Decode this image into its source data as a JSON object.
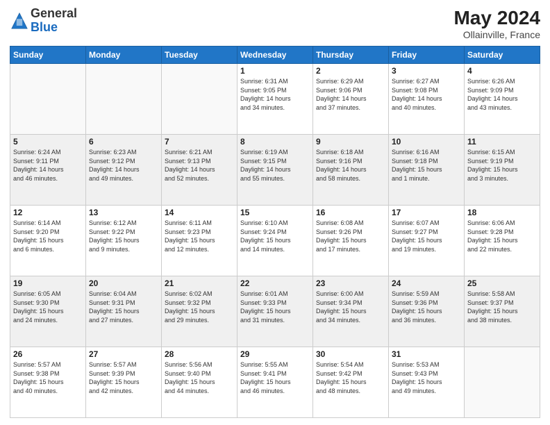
{
  "logo": {
    "general": "General",
    "blue": "Blue"
  },
  "title": {
    "month_year": "May 2024",
    "location": "Ollainville, France"
  },
  "days_of_week": [
    "Sunday",
    "Monday",
    "Tuesday",
    "Wednesday",
    "Thursday",
    "Friday",
    "Saturday"
  ],
  "weeks": [
    [
      {
        "day": "",
        "detail": ""
      },
      {
        "day": "",
        "detail": ""
      },
      {
        "day": "",
        "detail": ""
      },
      {
        "day": "1",
        "detail": "Sunrise: 6:31 AM\nSunset: 9:05 PM\nDaylight: 14 hours\nand 34 minutes."
      },
      {
        "day": "2",
        "detail": "Sunrise: 6:29 AM\nSunset: 9:06 PM\nDaylight: 14 hours\nand 37 minutes."
      },
      {
        "day": "3",
        "detail": "Sunrise: 6:27 AM\nSunset: 9:08 PM\nDaylight: 14 hours\nand 40 minutes."
      },
      {
        "day": "4",
        "detail": "Sunrise: 6:26 AM\nSunset: 9:09 PM\nDaylight: 14 hours\nand 43 minutes."
      }
    ],
    [
      {
        "day": "5",
        "detail": "Sunrise: 6:24 AM\nSunset: 9:11 PM\nDaylight: 14 hours\nand 46 minutes."
      },
      {
        "day": "6",
        "detail": "Sunrise: 6:23 AM\nSunset: 9:12 PM\nDaylight: 14 hours\nand 49 minutes."
      },
      {
        "day": "7",
        "detail": "Sunrise: 6:21 AM\nSunset: 9:13 PM\nDaylight: 14 hours\nand 52 minutes."
      },
      {
        "day": "8",
        "detail": "Sunrise: 6:19 AM\nSunset: 9:15 PM\nDaylight: 14 hours\nand 55 minutes."
      },
      {
        "day": "9",
        "detail": "Sunrise: 6:18 AM\nSunset: 9:16 PM\nDaylight: 14 hours\nand 58 minutes."
      },
      {
        "day": "10",
        "detail": "Sunrise: 6:16 AM\nSunset: 9:18 PM\nDaylight: 15 hours\nand 1 minute."
      },
      {
        "day": "11",
        "detail": "Sunrise: 6:15 AM\nSunset: 9:19 PM\nDaylight: 15 hours\nand 3 minutes."
      }
    ],
    [
      {
        "day": "12",
        "detail": "Sunrise: 6:14 AM\nSunset: 9:20 PM\nDaylight: 15 hours\nand 6 minutes."
      },
      {
        "day": "13",
        "detail": "Sunrise: 6:12 AM\nSunset: 9:22 PM\nDaylight: 15 hours\nand 9 minutes."
      },
      {
        "day": "14",
        "detail": "Sunrise: 6:11 AM\nSunset: 9:23 PM\nDaylight: 15 hours\nand 12 minutes."
      },
      {
        "day": "15",
        "detail": "Sunrise: 6:10 AM\nSunset: 9:24 PM\nDaylight: 15 hours\nand 14 minutes."
      },
      {
        "day": "16",
        "detail": "Sunrise: 6:08 AM\nSunset: 9:26 PM\nDaylight: 15 hours\nand 17 minutes."
      },
      {
        "day": "17",
        "detail": "Sunrise: 6:07 AM\nSunset: 9:27 PM\nDaylight: 15 hours\nand 19 minutes."
      },
      {
        "day": "18",
        "detail": "Sunrise: 6:06 AM\nSunset: 9:28 PM\nDaylight: 15 hours\nand 22 minutes."
      }
    ],
    [
      {
        "day": "19",
        "detail": "Sunrise: 6:05 AM\nSunset: 9:30 PM\nDaylight: 15 hours\nand 24 minutes."
      },
      {
        "day": "20",
        "detail": "Sunrise: 6:04 AM\nSunset: 9:31 PM\nDaylight: 15 hours\nand 27 minutes."
      },
      {
        "day": "21",
        "detail": "Sunrise: 6:02 AM\nSunset: 9:32 PM\nDaylight: 15 hours\nand 29 minutes."
      },
      {
        "day": "22",
        "detail": "Sunrise: 6:01 AM\nSunset: 9:33 PM\nDaylight: 15 hours\nand 31 minutes."
      },
      {
        "day": "23",
        "detail": "Sunrise: 6:00 AM\nSunset: 9:34 PM\nDaylight: 15 hours\nand 34 minutes."
      },
      {
        "day": "24",
        "detail": "Sunrise: 5:59 AM\nSunset: 9:36 PM\nDaylight: 15 hours\nand 36 minutes."
      },
      {
        "day": "25",
        "detail": "Sunrise: 5:58 AM\nSunset: 9:37 PM\nDaylight: 15 hours\nand 38 minutes."
      }
    ],
    [
      {
        "day": "26",
        "detail": "Sunrise: 5:57 AM\nSunset: 9:38 PM\nDaylight: 15 hours\nand 40 minutes."
      },
      {
        "day": "27",
        "detail": "Sunrise: 5:57 AM\nSunset: 9:39 PM\nDaylight: 15 hours\nand 42 minutes."
      },
      {
        "day": "28",
        "detail": "Sunrise: 5:56 AM\nSunset: 9:40 PM\nDaylight: 15 hours\nand 44 minutes."
      },
      {
        "day": "29",
        "detail": "Sunrise: 5:55 AM\nSunset: 9:41 PM\nDaylight: 15 hours\nand 46 minutes."
      },
      {
        "day": "30",
        "detail": "Sunrise: 5:54 AM\nSunset: 9:42 PM\nDaylight: 15 hours\nand 48 minutes."
      },
      {
        "day": "31",
        "detail": "Sunrise: 5:53 AM\nSunset: 9:43 PM\nDaylight: 15 hours\nand 49 minutes."
      },
      {
        "day": "",
        "detail": ""
      }
    ]
  ]
}
